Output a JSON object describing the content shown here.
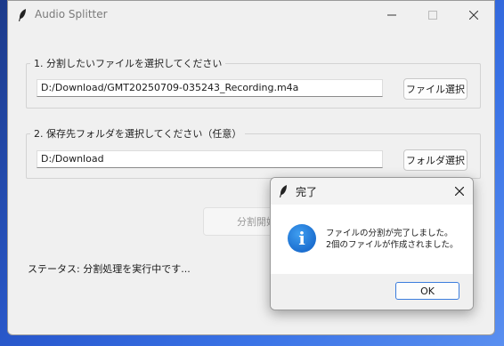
{
  "window": {
    "title": "Audio Splitter",
    "minimize_icon": "minimize-icon",
    "maximize_icon": "maximize-icon",
    "close_icon": "close-icon"
  },
  "file_section": {
    "legend": "1. 分割したいファイルを選択してください",
    "path_value": "D:/Download/GMT20250709-035243_Recording.m4a",
    "button_label": "ファイル選択"
  },
  "folder_section": {
    "legend": "2. 保存先フォルダを選択してください（任意）",
    "path_value": "D:/Download",
    "button_label": "フォルダ選択"
  },
  "split_button_label": "分割開始",
  "status_text": "ステータス: 分割処理を実行中です...",
  "dialog": {
    "title": "完了",
    "message_line1": "ファイルの分割が完了しました。",
    "message_line2": "2個のファイルが作成されました。",
    "icon": "info-icon",
    "icon_glyph": "i",
    "ok_label": "OK"
  },
  "colors": {
    "accent": "#3b7ddd",
    "info_icon": "#1c6fd0"
  }
}
